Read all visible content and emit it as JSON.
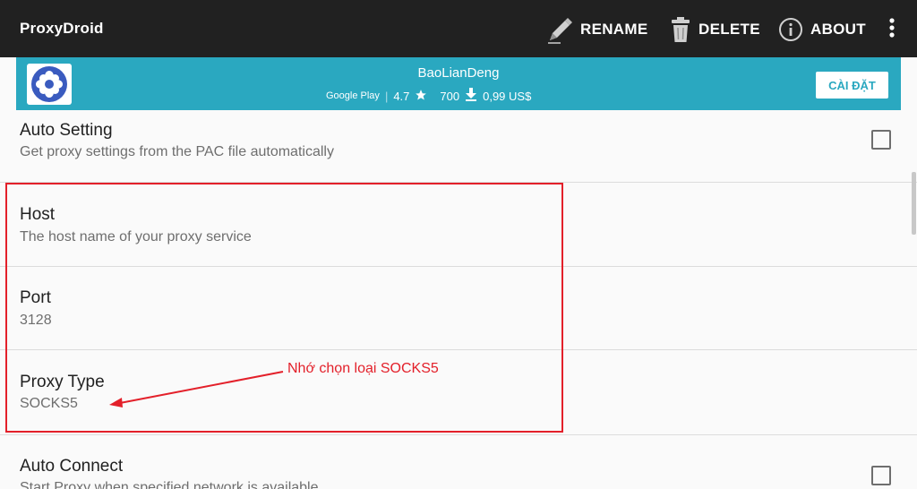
{
  "appbar": {
    "title": "ProxyDroid",
    "actions": {
      "rename": "RENAME",
      "delete": "DELETE",
      "about": "ABOUT"
    },
    "icons": {
      "rename": "pencil-icon",
      "delete": "trash-icon",
      "about": "info-icon",
      "overflow": "more-vert-icon"
    }
  },
  "ad": {
    "title": "BaoLianDeng",
    "store": "Google Play",
    "rating": "4.7",
    "downloads": "700",
    "price": "0,99 US$",
    "install_label": "CÀI ĐẶT",
    "colors": {
      "background": "#2aa8c0",
      "logo": "#3a5bbf"
    }
  },
  "preferences": {
    "auto_setting": {
      "title": "Auto Setting",
      "summary": "Get proxy settings from the PAC file automatically",
      "checked": false
    },
    "host": {
      "title": "Host",
      "summary": "The host name of your proxy service"
    },
    "port": {
      "title": "Port",
      "value": "3128"
    },
    "proxy_type": {
      "title": "Proxy Type",
      "value": "SOCKS5"
    },
    "auto_connect": {
      "title": "Auto Connect",
      "summary": "Start Proxy when specified network is available",
      "checked": false
    }
  },
  "annotation": {
    "text": "Nhớ chọn loại SOCKS5",
    "color": "#e3202a"
  }
}
